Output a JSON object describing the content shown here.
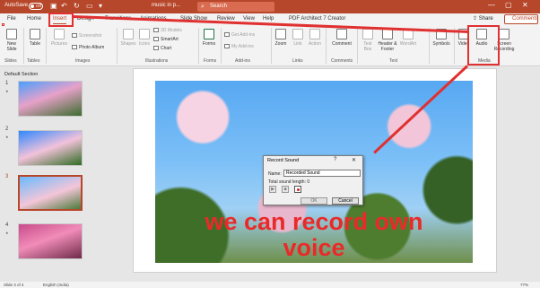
{
  "titlebar": {
    "autosave_label": "AutoSave",
    "toggle": "Off",
    "document_name": "music in p...",
    "search_placeholder": "Search",
    "window_buttons": [
      "—",
      "▢",
      "✕"
    ]
  },
  "tabs": [
    "File",
    "Home",
    "Insert",
    "Design",
    "Transitions",
    "Animations",
    "Slide Show",
    "Review",
    "View",
    "Help",
    "PDF Architect 7 Creator"
  ],
  "share_label": "Share",
  "comments_label": "Comments",
  "ribbon": {
    "new_slide": "New Slide",
    "table": "Table",
    "pictures": "Pictures",
    "screenshot": "Screenshot",
    "photo_album": "Photo Album",
    "shapes": "Shapes",
    "icons": "Icons",
    "models_3d": "3D Models",
    "smartart": "SmartArt",
    "chart": "Chart",
    "forms": "Forms",
    "get_addins": "Get Add-ins",
    "my_addins": "My Add-ins",
    "zoom": "Zoom",
    "link": "Link",
    "action": "Action",
    "comment": "Comment",
    "text_box": "Text Box",
    "header_footer": "Header & Footer",
    "wordart": "WordArt",
    "symbols": "Symbols",
    "video": "Video",
    "audio": "Audio",
    "screen_recording": "Screen Recording",
    "groups": {
      "slides": "Slides",
      "tables": "Tables",
      "images": "Images",
      "illustrations": "Illustrations",
      "forms": "Forms",
      "addins": "Add-ins",
      "links": "Links",
      "comments": "Comments",
      "text": "Text",
      "media": "Media"
    }
  },
  "thumbnails": {
    "section": "Default Section",
    "slides": [
      "1",
      "2",
      "3",
      "4"
    ]
  },
  "caption": {
    "line1": "we can record own",
    "line2": "voice"
  },
  "dialog": {
    "title": "Record Sound",
    "help": "?",
    "close": "✕",
    "name_label": "Name:",
    "name_value": "Recorded Sound",
    "length_label": "Total sound length:",
    "length_value": "0",
    "ok": "OK",
    "cancel": "Cancel"
  },
  "status": {
    "slide": "Slide 3 of 4",
    "language": "English (India)",
    "zoom": "77%"
  },
  "colors": {
    "accent": "#b7472a",
    "annotation": "#e03030",
    "caption": "#ea2a2a"
  }
}
